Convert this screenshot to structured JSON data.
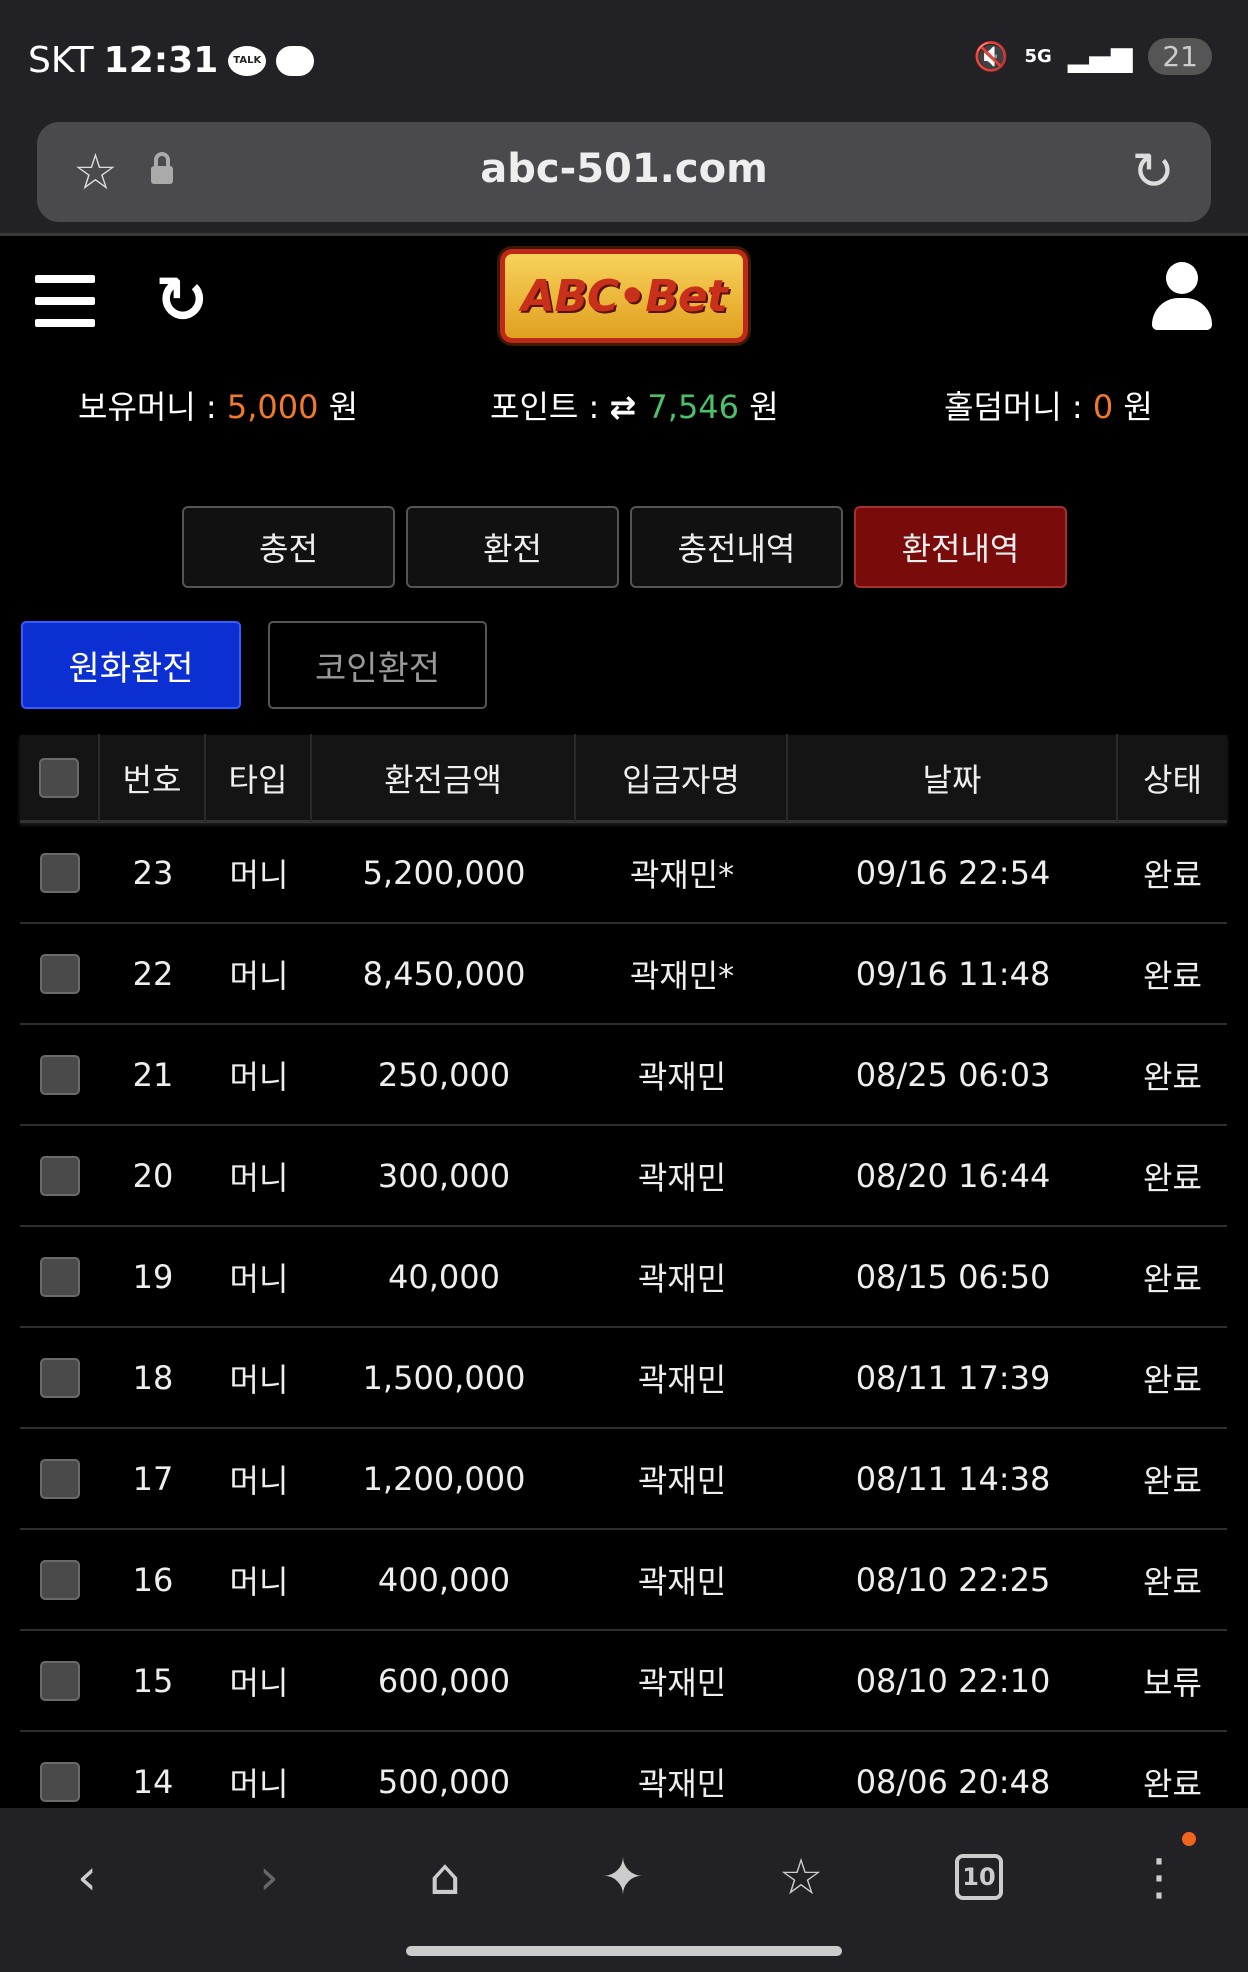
{
  "status_bar": {
    "carrier": "SKT",
    "time": "12:31",
    "talk_label": "TALK",
    "network": "5G",
    "battery": "21"
  },
  "browser": {
    "url": "abc-501.com",
    "tab_count": "10"
  },
  "site": {
    "logo_text": "ABC•Bet",
    "balances": {
      "money_label": "보유머니 : ",
      "money_value": "5,000",
      "money_unit": " 원",
      "point_label": "포인트 : ",
      "point_value": "7,546",
      "point_unit": " 원",
      "holdem_label": "홀덤머니 : ",
      "holdem_value": "0",
      "holdem_unit": " 원"
    },
    "tabs": [
      "충전",
      "환전",
      "충전내역",
      "환전내역"
    ],
    "active_tab": 3,
    "subtabs": [
      "원화환전",
      "코인환전"
    ]
  },
  "table": {
    "headers": [
      "번호",
      "타입",
      "환전금액",
      "입금자명",
      "날짜",
      "상태"
    ],
    "rows": [
      {
        "no": "23",
        "type": "머니",
        "amount": "5,200,000",
        "name": "곽재민*",
        "date": "09/16 22:54",
        "status": "완료"
      },
      {
        "no": "22",
        "type": "머니",
        "amount": "8,450,000",
        "name": "곽재민*",
        "date": "09/16 11:48",
        "status": "완료"
      },
      {
        "no": "21",
        "type": "머니",
        "amount": "250,000",
        "name": "곽재민",
        "date": "08/25 06:03",
        "status": "완료"
      },
      {
        "no": "20",
        "type": "머니",
        "amount": "300,000",
        "name": "곽재민",
        "date": "08/20 16:44",
        "status": "완료"
      },
      {
        "no": "19",
        "type": "머니",
        "amount": "40,000",
        "name": "곽재민",
        "date": "08/15 06:50",
        "status": "완료"
      },
      {
        "no": "18",
        "type": "머니",
        "amount": "1,500,000",
        "name": "곽재민",
        "date": "08/11 17:39",
        "status": "완료"
      },
      {
        "no": "17",
        "type": "머니",
        "amount": "1,200,000",
        "name": "곽재민",
        "date": "08/11 14:38",
        "status": "완료"
      },
      {
        "no": "16",
        "type": "머니",
        "amount": "400,000",
        "name": "곽재민",
        "date": "08/10 22:25",
        "status": "완료"
      },
      {
        "no": "15",
        "type": "머니",
        "amount": "600,000",
        "name": "곽재민",
        "date": "08/10 22:10",
        "status": "보류"
      },
      {
        "no": "14",
        "type": "머니",
        "amount": "500,000",
        "name": "곽재민",
        "date": "08/06 20:48",
        "status": "완료"
      }
    ]
  },
  "colors": {
    "accent_active_tab": "#7a0b0b",
    "accent_subtab": "#0b2fd1",
    "value_orange": "#f07a2a",
    "value_green": "#4cc06a"
  }
}
